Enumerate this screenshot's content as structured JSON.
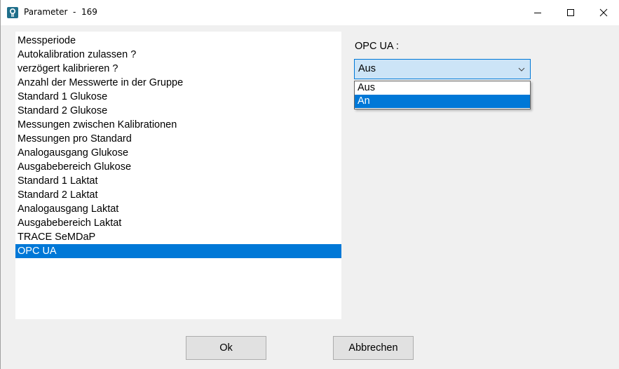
{
  "window": {
    "title": "Parameter  -  169",
    "minimize_icon": "minimize-icon",
    "maximize_icon": "maximize-icon",
    "close_icon": "close-icon"
  },
  "parameter_list": {
    "items": [
      "Messperiode",
      "Autokalibration zulassen ?",
      "verzögert kalibrieren ?",
      "Anzahl der Messwerte in der Gruppe",
      "Standard 1 Glukose",
      "Standard 2 Glukose",
      "Messungen zwischen Kalibrationen",
      "Messungen pro Standard",
      "Analogausgang Glukose",
      "Ausgabebereich Glukose",
      "Standard 1 Laktat",
      "Standard 2 Laktat",
      "Analogausgang Laktat",
      "Ausgabebereich Laktat",
      "TRACE SeMDaP",
      "OPC UA"
    ],
    "selected": "OPC UA"
  },
  "opc": {
    "label": "OPC UA :",
    "value": "Aus",
    "options": [
      "Aus",
      "An"
    ],
    "highlighted": "An"
  },
  "buttons": {
    "ok": "Ok",
    "cancel": "Abbrechen"
  },
  "colors": {
    "selection": "#0078d7",
    "combo_bg": "#cce4f7",
    "window_bg": "#f0f0f0"
  }
}
